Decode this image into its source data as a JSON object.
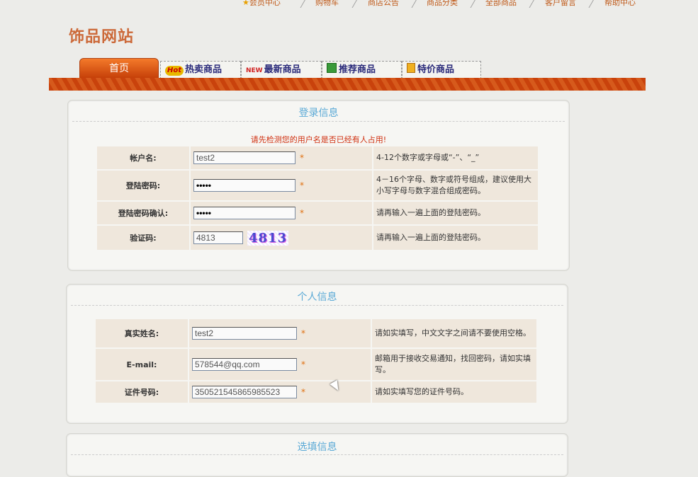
{
  "top_nav": [
    "会员中心",
    "购物车",
    "商店公告",
    "商品分类",
    "全部商品",
    "客户留言",
    "帮助中心"
  ],
  "site_title": "饰品网站",
  "tabs": {
    "home": "首页",
    "hot_badge": "Hot",
    "hot": "热卖商品",
    "new_badge": "NEW",
    "new": "最新商品",
    "recommend": "推荐商品",
    "special": "特价商品"
  },
  "login_section": {
    "title": "登录信息",
    "warning": "请先检测您的用户名是否已经有人占用!",
    "rows": [
      {
        "label": "帐户名:",
        "value": "test2",
        "hint": "4-12个数字或字母或“-”、“_”"
      },
      {
        "label": "登陆密码:",
        "value": "•••••",
        "hint": "4－16个字母、数字或符号组成，建议使用大小写字母与数字混合组成密码。"
      },
      {
        "label": "登陆密码确认:",
        "value": "•••••",
        "hint": "请再输入一遍上面的登陆密码。"
      },
      {
        "label": "验证码:",
        "value": "4813",
        "captcha": "4813",
        "hint": "请再输入一遍上面的登陆密码。"
      }
    ]
  },
  "personal_section": {
    "title": "个人信息",
    "rows": [
      {
        "label": "真实姓名:",
        "value": "test2",
        "hint": "请如实填写，中文文字之间请不要使用空格。"
      },
      {
        "label": "E-mail:",
        "value": "578544@qq.com",
        "hint": "邮箱用于接收交易通知，找回密码，请如实填写。"
      },
      {
        "label": "证件号码:",
        "value": "350521545865985523",
        "hint": "请如实填写您的证件号码。"
      }
    ]
  },
  "optional_section": {
    "title": "选填信息"
  },
  "required_mark": "*"
}
